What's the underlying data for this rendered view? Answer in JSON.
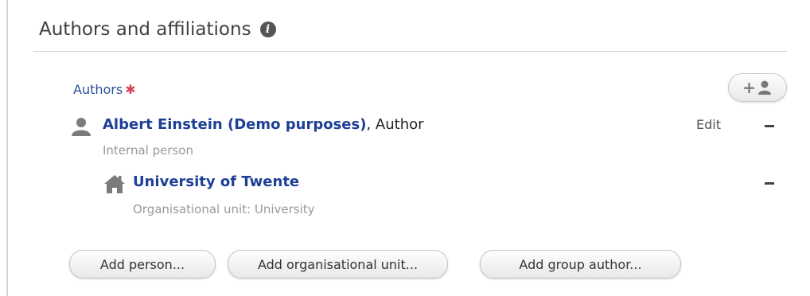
{
  "section": {
    "title": "Authors and affiliations",
    "info_icon": "info-icon"
  },
  "authors": {
    "label": "Authors",
    "required_marker": "✱",
    "add_icon": "add-person-icon",
    "entries": [
      {
        "icon": "person-icon",
        "name": "Albert Einstein (Demo purposes)",
        "separator": ",",
        "role": " Author",
        "type": "Internal person",
        "edit_label": "Edit",
        "affiliations": [
          {
            "icon": "home-icon",
            "name": "University of Twente",
            "type": "Organisational unit: University"
          }
        ]
      }
    ]
  },
  "actions": {
    "add_person": "Add person...",
    "add_org_unit": "Add organisational unit...",
    "add_group_author": "Add group author..."
  }
}
